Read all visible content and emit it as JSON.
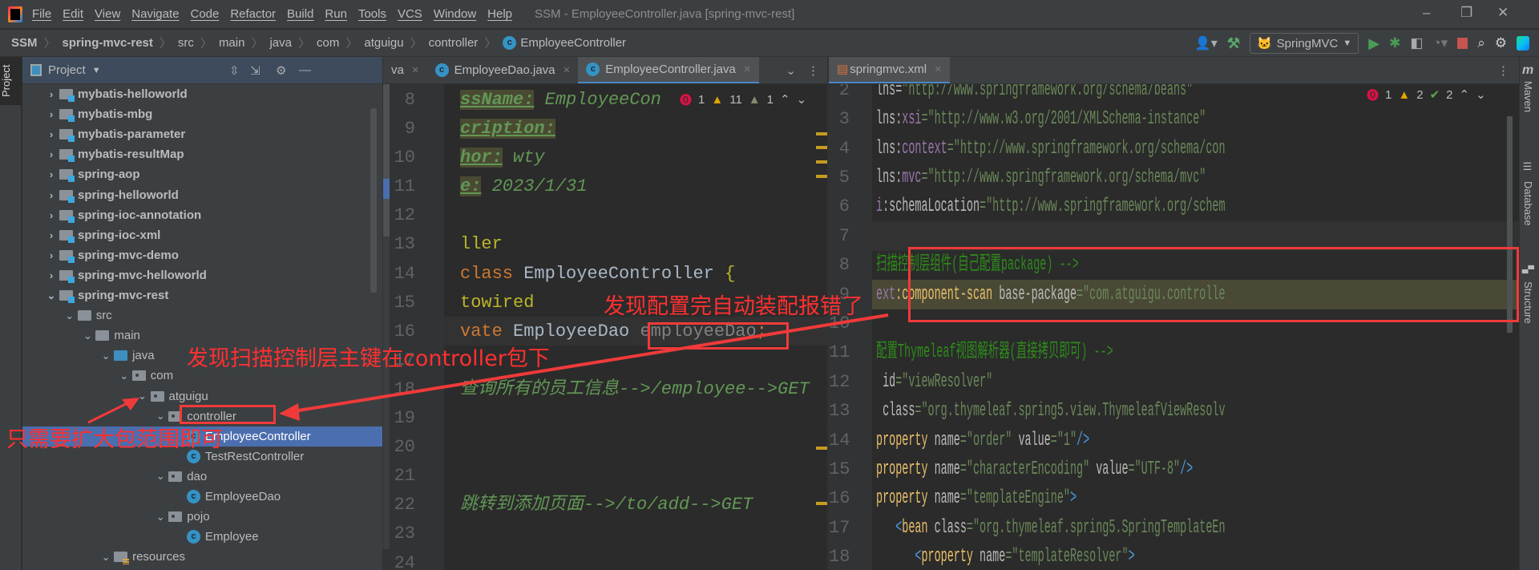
{
  "menubar": {
    "items": [
      "File",
      "Edit",
      "View",
      "Navigate",
      "Code",
      "Refactor",
      "Build",
      "Run",
      "Tools",
      "VCS",
      "Window",
      "Help"
    ],
    "title": "SSM - EmployeeController.java [spring-mvc-rest]"
  },
  "breadcrumb": [
    "SSM",
    "spring-mvc-rest",
    "src",
    "main",
    "java",
    "com",
    "atguigu",
    "controller",
    "EmployeeController"
  ],
  "toolbar": {
    "run_config": "SpringMVC"
  },
  "project": {
    "title": "Project",
    "stripe_label": "Project",
    "tree": [
      {
        "label": "mybatis-helloworld",
        "depth": 0,
        "chev": ">",
        "icon": "module",
        "bold": true
      },
      {
        "label": "mybatis-mbg",
        "depth": 0,
        "chev": ">",
        "icon": "module",
        "bold": true
      },
      {
        "label": "mybatis-parameter",
        "depth": 0,
        "chev": ">",
        "icon": "module",
        "bold": true
      },
      {
        "label": "mybatis-resultMap",
        "depth": 0,
        "chev": ">",
        "icon": "module",
        "bold": true
      },
      {
        "label": "spring-aop",
        "depth": 0,
        "chev": ">",
        "icon": "module",
        "bold": true
      },
      {
        "label": "spring-helloworld",
        "depth": 0,
        "chev": ">",
        "icon": "module",
        "bold": true
      },
      {
        "label": "spring-ioc-annotation",
        "depth": 0,
        "chev": ">",
        "icon": "module",
        "bold": true
      },
      {
        "label": "spring-ioc-xml",
        "depth": 0,
        "chev": ">",
        "icon": "module",
        "bold": true
      },
      {
        "label": "spring-mvc-demo",
        "depth": 0,
        "chev": ">",
        "icon": "module",
        "bold": true
      },
      {
        "label": "spring-mvc-helloworld",
        "depth": 0,
        "chev": ">",
        "icon": "module",
        "bold": true
      },
      {
        "label": "spring-mvc-rest",
        "depth": 0,
        "chev": "v",
        "icon": "module",
        "bold": true
      },
      {
        "label": "src",
        "depth": 1,
        "chev": "v",
        "icon": "folder"
      },
      {
        "label": "main",
        "depth": 2,
        "chev": "v",
        "icon": "folder"
      },
      {
        "label": "java",
        "depth": 3,
        "chev": "v",
        "icon": "src"
      },
      {
        "label": "com",
        "depth": 4,
        "chev": "v",
        "icon": "pkg"
      },
      {
        "label": "atguigu",
        "depth": 5,
        "chev": "v",
        "icon": "pkg"
      },
      {
        "label": "controller",
        "depth": 6,
        "chev": "v",
        "icon": "pkg"
      },
      {
        "label": "EmployeeController",
        "depth": 7,
        "chev": "",
        "icon": "class",
        "selected": true
      },
      {
        "label": "TestRestController",
        "depth": 7,
        "chev": "",
        "icon": "class"
      },
      {
        "label": "dao",
        "depth": 6,
        "chev": "v",
        "icon": "pkg"
      },
      {
        "label": "EmployeeDao",
        "depth": 7,
        "chev": "",
        "icon": "class"
      },
      {
        "label": "pojo",
        "depth": 6,
        "chev": "v",
        "icon": "pkg"
      },
      {
        "label": "Employee",
        "depth": 7,
        "chev": "",
        "icon": "class"
      },
      {
        "label": "resources",
        "depth": 3,
        "chev": "v",
        "icon": "res"
      }
    ]
  },
  "left_editor": {
    "tabs": [
      {
        "label": "va",
        "icon": false
      },
      {
        "label": "EmployeeDao.java",
        "icon": true
      },
      {
        "label": "EmployeeController.java",
        "icon": true,
        "active": true
      }
    ],
    "inspections": {
      "errors": "1",
      "warnings": "11",
      "weak": "1"
    },
    "lines": [
      {
        "n": "8",
        "t": [
          [
            "ssName:",
            "cmb"
          ],
          [
            " EmployeeCon",
            "cm"
          ]
        ]
      },
      {
        "n": "9",
        "t": [
          [
            "cription:",
            "cmb"
          ]
        ]
      },
      {
        "n": "10",
        "t": [
          [
            "hor:",
            "cmb"
          ],
          [
            " wty",
            "cm"
          ]
        ]
      },
      {
        "n": "11",
        "t": [
          [
            "e:",
            "cmb"
          ],
          [
            " 2023/1/31",
            "cm"
          ]
        ]
      },
      {
        "n": "12",
        "t": []
      },
      {
        "n": "13",
        "t": [
          [
            "ller",
            "tag"
          ]
        ]
      },
      {
        "n": "14",
        "t": [
          [
            "class ",
            "kw"
          ],
          [
            "EmployeeController ",
            "id"
          ],
          [
            "{",
            "tag"
          ]
        ]
      },
      {
        "n": "15",
        "t": [
          [
            "towired",
            "tag"
          ]
        ]
      },
      {
        "n": "16",
        "t": [
          [
            "vate ",
            "kw"
          ],
          [
            "EmployeeDao ",
            "id"
          ],
          [
            "employeeDao",
            "dim"
          ],
          [
            ";",
            "kw"
          ]
        ]
      },
      {
        "n": "17",
        "t": []
      },
      {
        "n": "18",
        "t": [
          [
            "查询所有的员工信息-->/employee-->GET",
            "cm"
          ]
        ]
      },
      {
        "n": "19",
        "t": []
      },
      {
        "n": "20",
        "t": []
      },
      {
        "n": "21",
        "t": []
      },
      {
        "n": "22",
        "t": [
          [
            "跳转到添加页面-->/to/add-->GET",
            "cm"
          ]
        ]
      },
      {
        "n": "23",
        "t": []
      },
      {
        "n": "24",
        "t": []
      }
    ]
  },
  "right_editor": {
    "tabs": [
      {
        "label": "springmvc.xml",
        "active": true
      }
    ],
    "inspections": {
      "errors": "1",
      "warnings": "2",
      "ok": "2"
    },
    "lines": [
      {
        "n": "2",
        "t": [
          [
            "lns",
            "attr"
          ],
          [
            "=",
            "attr"
          ],
          [
            "\"http://www.springframework.org/schema/beans\"",
            "str"
          ]
        ]
      },
      {
        "n": "3",
        "t": [
          [
            "lns:",
            "attr"
          ],
          [
            "xsi",
            "ns"
          ],
          [
            "=\"http://www.w3.org/2001/XMLSchema-instance\"",
            "str"
          ]
        ]
      },
      {
        "n": "4",
        "t": [
          [
            "lns:",
            "attr"
          ],
          [
            "context",
            "ns"
          ],
          [
            "=\"http://www.springframework.org/schema/con",
            "str"
          ]
        ]
      },
      {
        "n": "5",
        "t": [
          [
            "lns:",
            "attr"
          ],
          [
            "mvc",
            "ns"
          ],
          [
            "=\"http://www.springframework.org/schema/mvc\"",
            "str"
          ]
        ]
      },
      {
        "n": "6",
        "t": [
          [
            "i",
            "ns"
          ],
          [
            ":schemaLocation",
            "attr"
          ],
          [
            "=\"http://www.springframework.org/schem",
            "str"
          ]
        ]
      },
      {
        "n": "7",
        "t": []
      },
      {
        "n": "8",
        "t": [
          [
            "扫描控制层组件(自己配置package) -->",
            "xcm"
          ]
        ]
      },
      {
        "n": "9",
        "t": [
          [
            "ext",
            "ns"
          ],
          [
            ":component-scan ",
            "xtag"
          ],
          [
            "base-package",
            "attr"
          ],
          [
            "=\"com.atguigu.controlle",
            "str"
          ]
        ]
      },
      {
        "n": "10",
        "t": []
      },
      {
        "n": "11",
        "t": [
          [
            "配置Thymeleaf视图解析器(直接拷贝即可) -->",
            "xcm"
          ]
        ]
      },
      {
        "n": "12",
        "t": [
          [
            " id",
            "attr"
          ],
          [
            "=\"viewResolver\"",
            "str"
          ]
        ]
      },
      {
        "n": "13",
        "t": [
          [
            " class",
            "attr"
          ],
          [
            "=\"org.thymeleaf.spring5.view.ThymeleafViewResolv",
            "str"
          ]
        ]
      },
      {
        "n": "14",
        "t": [
          [
            "property ",
            "xtag"
          ],
          [
            "name",
            "attr"
          ],
          [
            "=\"order\" ",
            "str"
          ],
          [
            "value",
            "attr"
          ],
          [
            "=\"1\"",
            "str"
          ],
          [
            "/>",
            "pun"
          ]
        ]
      },
      {
        "n": "15",
        "t": [
          [
            "property ",
            "xtag"
          ],
          [
            "name",
            "attr"
          ],
          [
            "=\"characterEncoding\" ",
            "str"
          ],
          [
            "value",
            "attr"
          ],
          [
            "=\"UTF-8\"",
            "str"
          ],
          [
            "/>",
            "pun"
          ]
        ]
      },
      {
        "n": "16",
        "t": [
          [
            "property ",
            "xtag"
          ],
          [
            "name",
            "attr"
          ],
          [
            "=\"templateEngine\"",
            "str"
          ],
          [
            ">",
            "pun"
          ]
        ]
      },
      {
        "n": "17",
        "t": [
          [
            "   <",
            "pun"
          ],
          [
            "bean ",
            "xtag"
          ],
          [
            "class",
            "attr"
          ],
          [
            "=\"org.thymeleaf.spring5.SpringTemplateEn",
            "str"
          ]
        ]
      },
      {
        "n": "18",
        "t": [
          [
            "      <",
            "pun"
          ],
          [
            "property ",
            "xtag"
          ],
          [
            "name",
            "attr"
          ],
          [
            "=\"templateResolver\"",
            "str"
          ],
          [
            ">",
            "pun"
          ]
        ]
      }
    ]
  },
  "right_stripe": [
    "Maven",
    "Database",
    "Structure"
  ],
  "annotations": {
    "controller_package": "发现扫描控制层主键在controller包下",
    "expand_scope": "只需要扩大包范围即可",
    "autowire_error": "发现配置完自动装配报错了"
  },
  "colors": {
    "annotation_red": "#f03a3a",
    "selection": "#4b6eaf",
    "accent": "#4a88c7"
  }
}
